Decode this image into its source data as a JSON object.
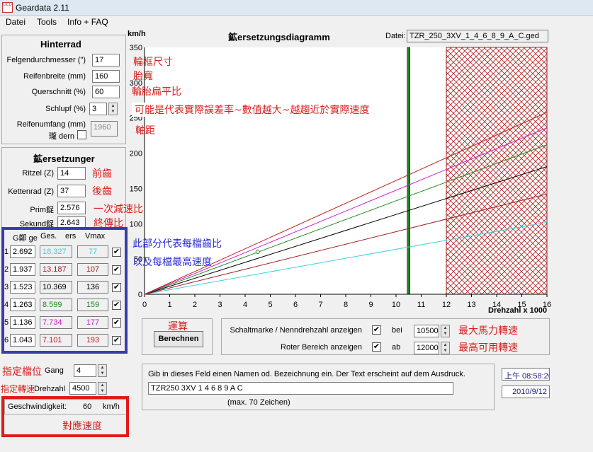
{
  "window": {
    "title": "Geardata 2.11",
    "icon_text": "GED"
  },
  "menu": [
    "Datei",
    "Tools",
    "Info + FAQ"
  ],
  "hinterrad": {
    "title": "Hinterrad",
    "felgen_label": "Felgendurchmesser (\")",
    "felgen_value": "17",
    "breite_label": "Reifenbreite (mm)",
    "breite_value": "160",
    "quer_label": "Querschnitt (%)",
    "quer_value": "60",
    "schlupf_label": "Schlupf (%)",
    "schlupf_value": "3",
    "umfang_label": "Reifenumfang (mm)",
    "aendern_label": "瓏 dern",
    "umfang_value": "1960"
  },
  "uebersetzungen": {
    "title": "鉱ersetzunger",
    "ritzel_label": "Ritzel (Z)",
    "ritzel_value": "14",
    "kettenrad_label": "Kettenrad (Z)",
    "kettenrad_value": "37",
    "primaer_label": "Prim鋜",
    "primaer_value": "2.576",
    "sekundaer_label": "Sekund鋜",
    "sekundaer_value": "2.643"
  },
  "gears_header": {
    "gang": "G鄭 ge",
    "ges": "Ges.",
    "ers": "ers",
    "vmax": "Vmax"
  },
  "gears": [
    {
      "n": "1",
      "ratio": "2.692",
      "ges": "18.327",
      "vmax": "77",
      "color": "#3ad0e0"
    },
    {
      "n": "2",
      "ratio": "1.937",
      "ges": "13.187",
      "vmax": "107",
      "color": "#9b2020"
    },
    {
      "n": "3",
      "ratio": "1.523",
      "ges": "10.369",
      "vmax": "136",
      "color": "#000000"
    },
    {
      "n": "4",
      "ratio": "1.263",
      "ges": "8.599",
      "vmax": "159",
      "color": "#1e8a1e"
    },
    {
      "n": "5",
      "ratio": "1.136",
      "ges": "7.734",
      "vmax": "177",
      "color": "#d020d0"
    },
    {
      "n": "6",
      "ratio": "1.043",
      "ges": "7.101",
      "vmax": "193",
      "color": "#c02020"
    }
  ],
  "gang_section": {
    "gang_label": "Gang",
    "gang_value": "4",
    "drehzahl_label": "Drehzahl",
    "drehzahl_value": "4500"
  },
  "speed": {
    "label": "Geschwindigkeit:",
    "value": "60",
    "unit": "km/h"
  },
  "diagram": {
    "title": "鉱ersetzungsdiagramm",
    "file_label": "Datei:",
    "file_name": "TZR_250_3XV_1_4_6_8_9_A_C.ged",
    "y_unit": "km/h",
    "x_unit": "Drehzahl x 1000"
  },
  "controls": {
    "berechnen_label": "Berechnen",
    "schaltmarke_label": "Schaltmarke / Nenndrehzahl anzeigen",
    "bei_label": "bei",
    "bei_value": "10500",
    "roter_label": "Roter Bereich anzeigen",
    "ab_label": "ab",
    "ab_value": "12000"
  },
  "note": {
    "hint": "Gib in dieses Feld einen Namen od. Bezeichnung ein. Der Text erscheint auf dem Ausdruck.",
    "value": "TZR250 3XV 1 4 6 8 9 A C",
    "max": "(max. 70 Zeichen)"
  },
  "clock": {
    "time": "上午 08:58:26",
    "date": "2010/9/12"
  },
  "annotations": {
    "rim": "輪框尺寸",
    "width": "胎寬",
    "aspect": "輪胎扁平比",
    "slip": "可能是代表實際誤差率~數值越大~越趨近於實際速度",
    "circ": "軸距",
    "front": "前齒",
    "rear": "後齒",
    "primary": "一次減速比",
    "final": "終傳比",
    "gear_ratio": "此部分代表每檔齒比",
    "gear_max": "以及每檔最高速度",
    "calc": "運算",
    "max_hp": "最大馬力轉速",
    "max_rpm": "最高可用轉速",
    "gear_sel": "指定檔位",
    "rpm_sel": "指定轉速",
    "speed_sel": "對應速度"
  },
  "chart_data": {
    "type": "line",
    "title": "鉱ersetzungsdiagramm",
    "xlabel": "Drehzahl x 1000",
    "ylabel": "km/h",
    "xlim": [
      0,
      16
    ],
    "ylim": [
      0,
      350
    ],
    "x_ticks": [
      0,
      1,
      2,
      3,
      4,
      5,
      6,
      7,
      8,
      9,
      10,
      11,
      12,
      13,
      14,
      15,
      16
    ],
    "y_ticks": [
      0,
      50,
      100,
      150,
      200,
      250,
      300,
      350
    ],
    "series": [
      {
        "x": [
          0,
          16
        ],
        "y": [
          0,
          102
        ],
        "color": "#3ad0e0"
      },
      {
        "x": [
          0,
          16
        ],
        "y": [
          0,
          142
        ],
        "color": "#9b2020"
      },
      {
        "x": [
          0,
          16
        ],
        "y": [
          0,
          181
        ],
        "color": "#000000"
      },
      {
        "x": [
          0,
          16
        ],
        "y": [
          0,
          212
        ],
        "color": "#1e8a1e"
      },
      {
        "x": [
          0,
          16
        ],
        "y": [
          0,
          236
        ],
        "color": "#d020d0"
      },
      {
        "x": [
          0,
          16
        ],
        "y": [
          0,
          258
        ],
        "color": "#c02020"
      }
    ],
    "shift_mark_rpm": 10.5,
    "red_zone_from": 12,
    "marker": {
      "x": 4.5,
      "y": 60
    }
  }
}
